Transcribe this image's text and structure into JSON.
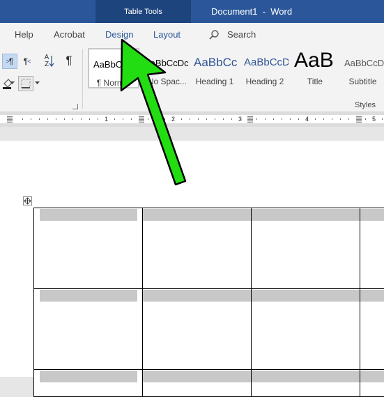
{
  "titlebar": {
    "contextual_tab_group": "Table Tools",
    "document_title": "Document1  -  Word"
  },
  "tabs": [
    {
      "label": "Help"
    },
    {
      "label": "Acrobat"
    },
    {
      "label": "Design"
    },
    {
      "label": "Layout"
    }
  ],
  "search": {
    "label": "Search",
    "icon": "search-icon"
  },
  "paragraph_tools": {
    "ltr_label": "¶",
    "rtl_label": "¶",
    "sort_top": "A",
    "sort_bottom": "Z",
    "show_marks_label": "¶"
  },
  "styles_gallery": {
    "group_label": "Styles",
    "items": [
      {
        "preview": "AaBbCcDc",
        "caption": "¶ Normal",
        "selected": true
      },
      {
        "preview": "AaBbCcDc",
        "caption": "¶ No Spac..."
      },
      {
        "preview": "AaBbCc",
        "caption": "Heading 1",
        "color": "#2f5496"
      },
      {
        "preview": "AaBbCcD",
        "caption": "Heading 2",
        "color": "#2f5496"
      },
      {
        "preview": "AaB",
        "caption": "Title"
      },
      {
        "preview": "AaBbCcD",
        "caption": "Subtitle",
        "color": "#595959"
      }
    ]
  },
  "ruler": {
    "numbers": [
      "1",
      "2",
      "3",
      "4",
      "5"
    ]
  },
  "annotation": {
    "arrow_color": "#22dd11",
    "target": "Design tab"
  },
  "colors": {
    "word_blue": "#2b579a",
    "context_tab_bg": "#1e447d",
    "ribbon_bg": "#f3f3f3",
    "cell_shading": "#c8c8c8"
  }
}
